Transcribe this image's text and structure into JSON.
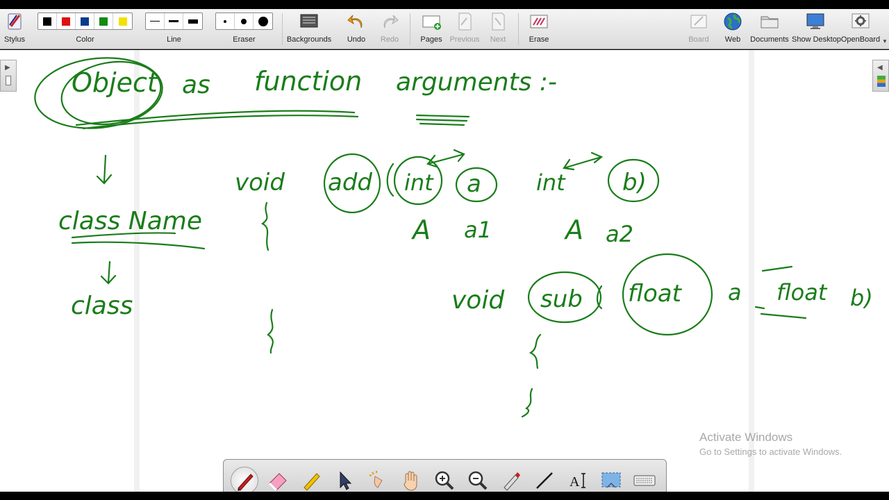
{
  "toolbar": {
    "stylus": "Stylus",
    "color": "Color",
    "line": "Line",
    "eraser": "Eraser",
    "backgrounds": "Backgrounds",
    "undo": "Undo",
    "redo": "Redo",
    "pages": "Pages",
    "previous": "Previous",
    "next": "Next",
    "erase": "Erase",
    "board": "Board",
    "web": "Web",
    "documents": "Documents",
    "show_desktop": "Show Desktop",
    "openboard": "OpenBoard"
  },
  "colors": {
    "black": "#000000",
    "red": "#e01010",
    "blue": "#0a3c8c",
    "green": "#138a13",
    "yellow": "#f5e000",
    "ink": "#1a7d1a"
  },
  "handwriting": {
    "title_word1": "Object",
    "title_word2": "as",
    "title_word3": "function",
    "title_word4": "arguments :-",
    "class_name": "class Name",
    "class_kw": "class",
    "void1": "void",
    "add": "add",
    "int1": "int",
    "a": "a",
    "int2": "int",
    "b": "b)",
    "A1": "A",
    "a1": "a1",
    "A2": "A",
    "a2": "a2",
    "void2": "void",
    "sub": "sub",
    "float1": "float",
    "a_second": "a",
    "float2": "float",
    "b_second": "b)"
  },
  "watermark": {
    "line1": "Activate Windows",
    "line2": "Go to Settings to activate Windows."
  },
  "palette": {
    "tools": [
      "pen-icon",
      "eraser-icon",
      "marker-icon",
      "pointer-icon",
      "laser-icon",
      "hand-icon",
      "zoom-in-icon",
      "zoom-out-icon",
      "capture-pen-icon",
      "line-icon",
      "text-icon",
      "screenshot-icon",
      "keyboard-icon"
    ]
  }
}
